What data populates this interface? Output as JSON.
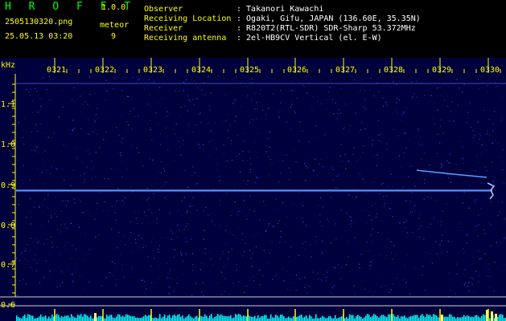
{
  "app": {
    "name": "H R O F F T",
    "version": "1.0.0"
  },
  "file": {
    "name": "2505130320.png",
    "datetime": "25.05.13 03:20"
  },
  "meteor": {
    "label": "meteor",
    "count": "9"
  },
  "info": [
    {
      "key": "Observer",
      "value": ": Takanori Kawachi"
    },
    {
      "key": "Receiving Location",
      "value": ": Ogaki, Gifu, JAPAN (136.60E, 35.35N)"
    },
    {
      "key": "Receiver",
      "value": ": R820T2(RTL-SDR) SDR-Sharp 53.372MHz"
    },
    {
      "key": "Receiving antenna",
      "value": ": 2el-HB9CV Vertical (el. E-W)"
    }
  ],
  "axis": {
    "unit": "kHz",
    "time_ticks": [
      "0321",
      "0322",
      "0323",
      "0324",
      "0325",
      "0326",
      "0327",
      "0328",
      "0329",
      "0330"
    ],
    "freq_ticks": [
      "1.1",
      "1.0",
      "0.9",
      "0.8",
      "0.7",
      "0.6"
    ]
  },
  "colors": {
    "background": "#00003c",
    "carrier": "#3d86ff",
    "meteor_trail": "#5aa0ff",
    "axis_text": "#ffff00",
    "level_bars": "#00ffff"
  }
}
